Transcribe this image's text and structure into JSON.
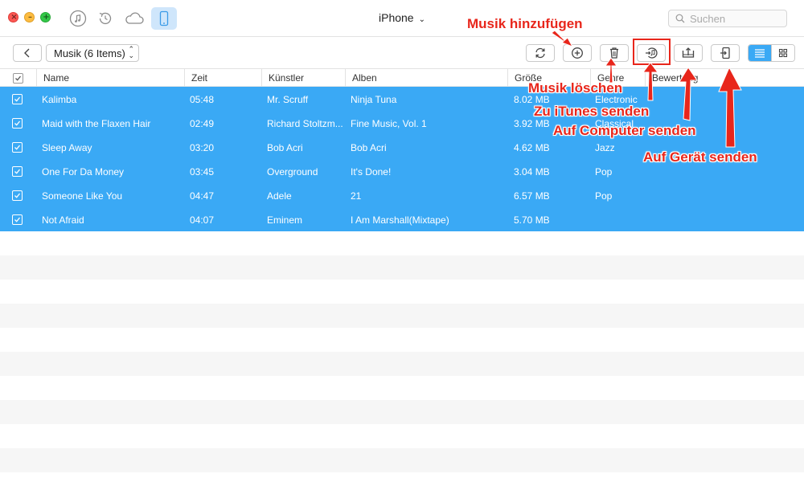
{
  "titlebar": {
    "device_name": "iPhone",
    "search_placeholder": "Suchen",
    "icons": [
      "music-icon",
      "history-icon",
      "cloud-icon",
      "device-icon"
    ]
  },
  "toolbar": {
    "category": "Musik (6 Items)",
    "buttons": [
      "refresh-icon",
      "add-icon",
      "trash-icon",
      "itunes-icon",
      "to-computer-icon",
      "to-device-icon"
    ],
    "view_modes": [
      "list-view",
      "grid-view"
    ]
  },
  "table": {
    "columns": [
      "Name",
      "Zeit",
      "Künstler",
      "Alben",
      "Größe",
      "Genre",
      "Bewertung"
    ],
    "rows": [
      {
        "name": "Kalimba",
        "time": "05:48",
        "artist": "Mr. Scruff",
        "album": "Ninja Tuna",
        "size": "8.02 MB",
        "genre": "Electronic"
      },
      {
        "name": "Maid with the Flaxen Hair",
        "time": "02:49",
        "artist": "Richard Stoltzm...",
        "album": "Fine Music, Vol. 1",
        "size": "3.92 MB",
        "genre": "Classical"
      },
      {
        "name": "Sleep Away",
        "time": "03:20",
        "artist": "Bob Acri",
        "album": "Bob Acri",
        "size": "4.62 MB",
        "genre": "Jazz"
      },
      {
        "name": "One For Da Money",
        "time": "03:45",
        "artist": "Overground",
        "album": "It's Done!",
        "size": "3.04 MB",
        "genre": "Pop"
      },
      {
        "name": "Someone Like You",
        "time": "04:47",
        "artist": "Adele",
        "album": "21",
        "size": "6.57 MB",
        "genre": "Pop"
      },
      {
        "name": "Not Afraid",
        "time": "04:07",
        "artist": "Eminem",
        "album": "I Am Marshall(Mixtape)",
        "size": "5.70 MB",
        "genre": ""
      }
    ]
  },
  "annotations": {
    "add": "Musik hinzufügen",
    "delete": "Musik löschen",
    "itunes": "Zu iTunes senden",
    "computer": "Auf Computer senden",
    "device": "Auf Gerät senden"
  },
  "colors": {
    "selection": "#3aa9f5",
    "annotation": "#e8261b"
  }
}
